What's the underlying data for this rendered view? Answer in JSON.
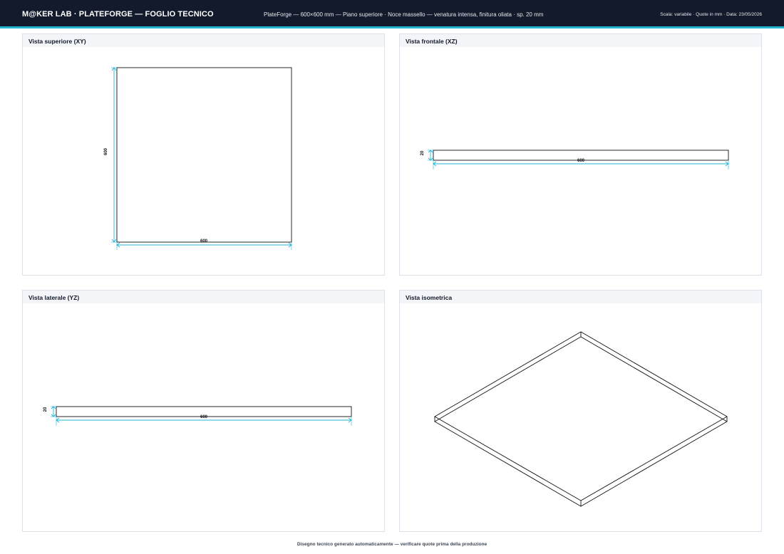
{
  "header": {
    "brand": "M@KER LAB · PLATEFORGE — FOGLIO TECNICO",
    "subtitle": "PlateForge — 600×600 mm — Piano superiore · Noce massello — venatura intensa, finitura oliata · sp. 20 mm",
    "meta": "Scala: variabile · Quote in mm · Data: 23/05/2026",
    "accent_color": "#22b5d4",
    "bar_color": "#121a2b"
  },
  "part": {
    "width_mm": 600,
    "depth_mm": 600,
    "thickness_mm": 20
  },
  "views": {
    "top": {
      "title": "Vista superiore (XY)",
      "dim_h": "600",
      "dim_v": "600"
    },
    "front": {
      "title": "Vista frontale (XZ)",
      "dim_h": "600",
      "dim_v": "20"
    },
    "side": {
      "title": "Vista laterale (YZ)",
      "dim_h": "600",
      "dim_v": "20"
    },
    "iso": {
      "title": "Vista isometrica"
    }
  },
  "footer": {
    "text": "Disegno tecnico generato automaticamente — verificare quote prima della produzione"
  }
}
